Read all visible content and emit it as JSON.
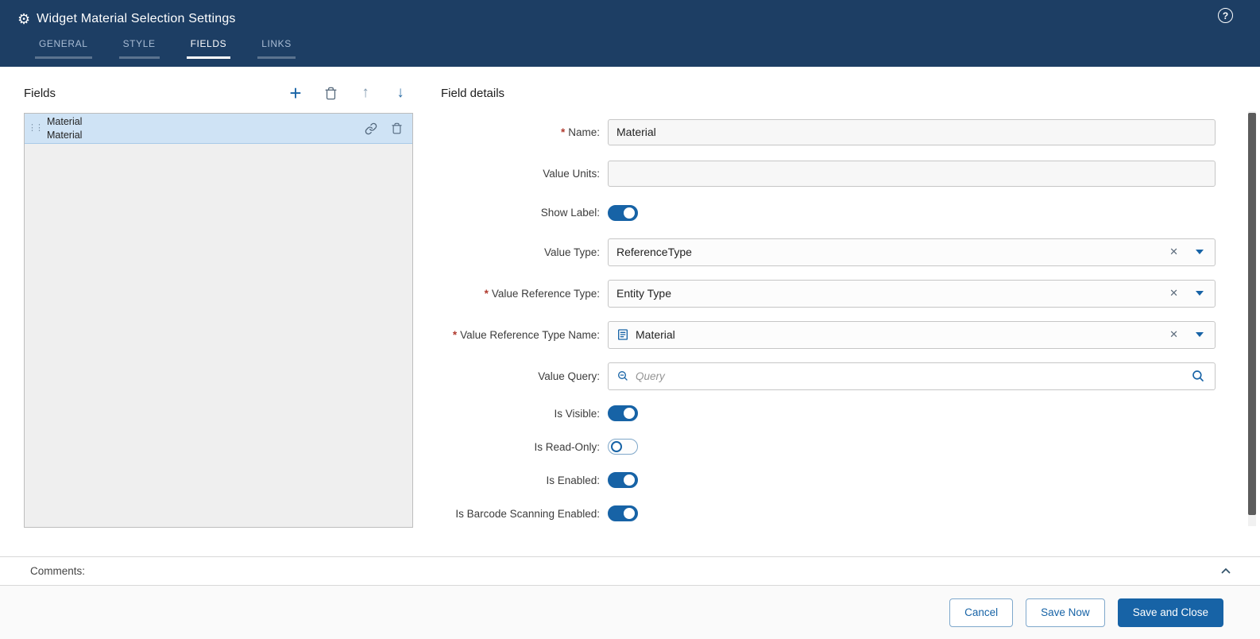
{
  "colors": {
    "header_bg": "#1d3e64",
    "accent": "#1763a6",
    "selected_row_bg": "#cfe3f5",
    "required_mark": "#b03a2e"
  },
  "icons": {
    "gear": "⚙",
    "help": "?",
    "plus": "+",
    "arrow_up": "↑",
    "arrow_down": "↓",
    "clear": "✕",
    "drag_handle": "⋮⋮"
  },
  "header": {
    "title": "Widget Material Selection Settings",
    "tabs": [
      {
        "label": "GENERAL",
        "active": false
      },
      {
        "label": "STYLE",
        "active": false
      },
      {
        "label": "FIELDS",
        "active": true
      },
      {
        "label": "LINKS",
        "active": false
      }
    ]
  },
  "fields_panel": {
    "title": "Fields",
    "items": [
      {
        "line1": "Material",
        "line2": "Material",
        "selected": true
      }
    ]
  },
  "details_panel": {
    "title": "Field details",
    "required_marker": "*",
    "rows": [
      {
        "label": "Name:",
        "required": true,
        "control": "text",
        "value": "Material"
      },
      {
        "label": "Value Units:",
        "required": false,
        "control": "text",
        "value": ""
      },
      {
        "label": "Show Label:",
        "required": false,
        "control": "toggle",
        "on": true
      },
      {
        "label": "Value Type:",
        "required": false,
        "control": "select",
        "value": "ReferenceType"
      },
      {
        "label": "Value Reference Type:",
        "required": true,
        "control": "select",
        "value": "Entity Type"
      },
      {
        "label": "Value Reference Type Name:",
        "required": true,
        "control": "select",
        "value": "Material",
        "has_entity_icon": true
      },
      {
        "label": "Value Query:",
        "required": false,
        "control": "query",
        "value": "",
        "placeholder": "Query"
      },
      {
        "label": "Is Visible:",
        "required": false,
        "control": "toggle",
        "on": true
      },
      {
        "label": "Is Read-Only:",
        "required": false,
        "control": "toggle",
        "on": false
      },
      {
        "label": "Is Enabled:",
        "required": false,
        "control": "toggle",
        "on": true
      },
      {
        "label": "Is Barcode Scanning Enabled:",
        "required": false,
        "control": "toggle",
        "on": true
      }
    ]
  },
  "comments": {
    "label": "Comments:"
  },
  "footer": {
    "buttons": [
      {
        "label": "Cancel",
        "primary": false
      },
      {
        "label": "Save Now",
        "primary": false
      },
      {
        "label": "Save and Close",
        "primary": true
      }
    ]
  }
}
